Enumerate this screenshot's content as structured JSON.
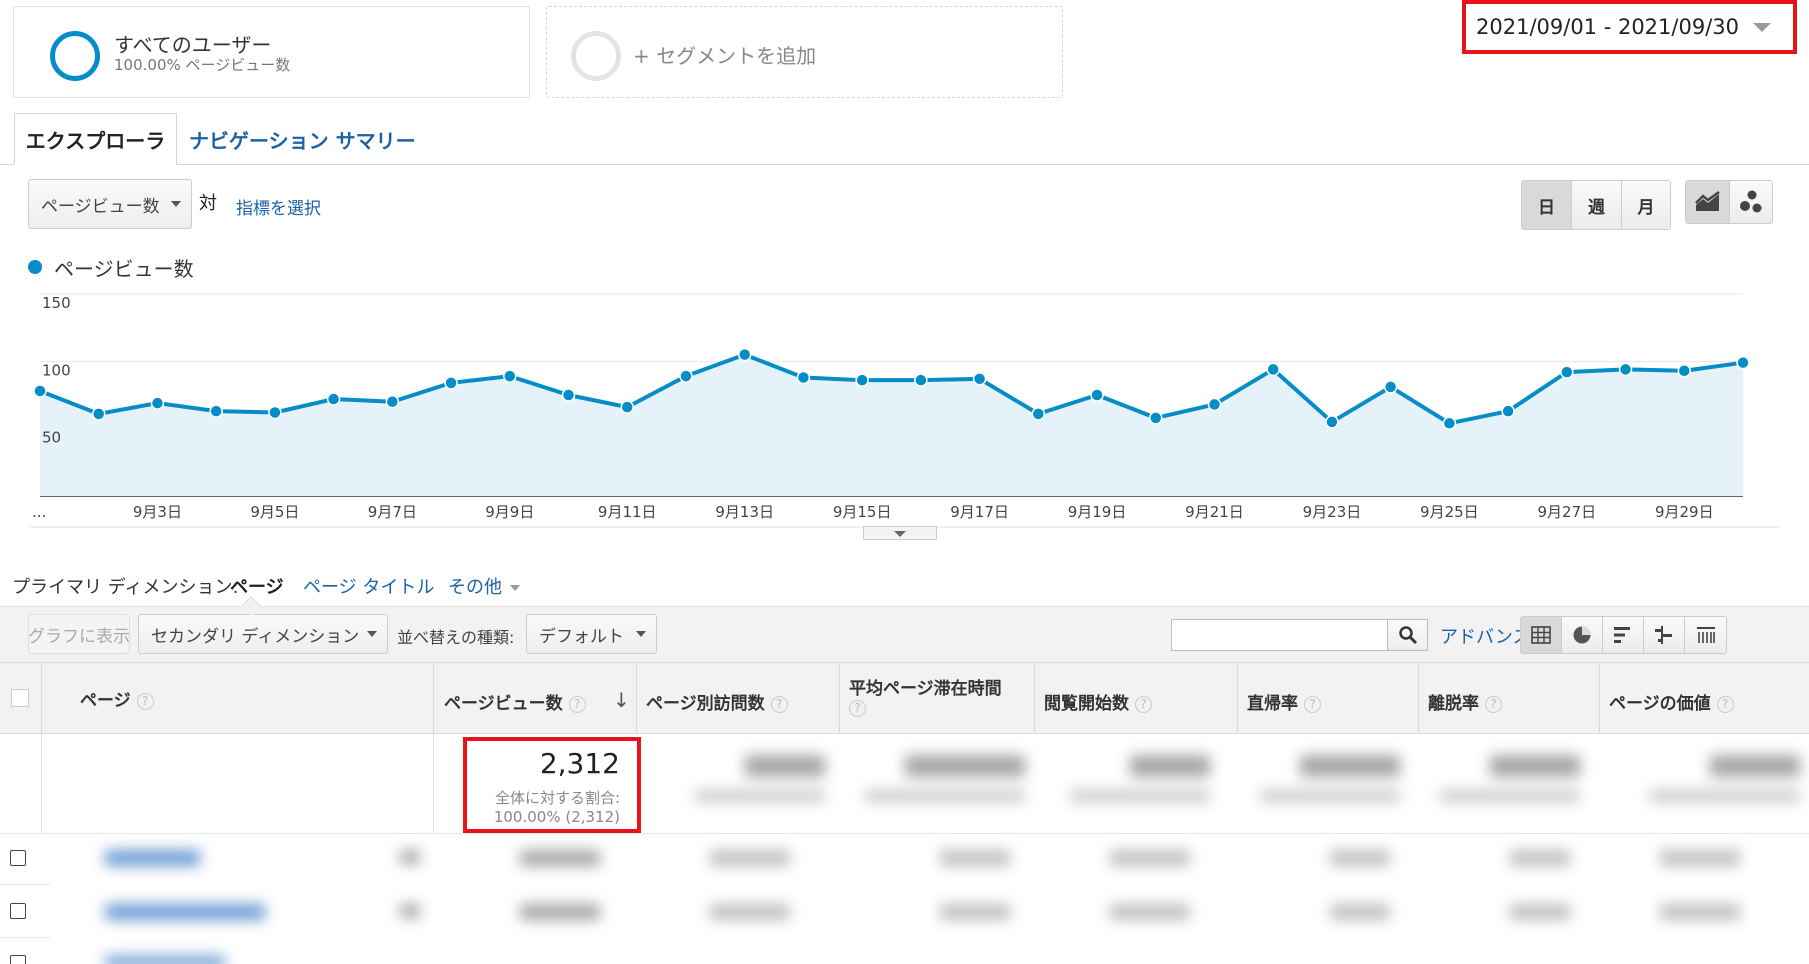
{
  "segments": {
    "all_users": {
      "title": "すべてのユーザー",
      "subtitle": "100.00% ページビュー数"
    },
    "add": {
      "label": "+ セグメントを追加"
    }
  },
  "date_range": "2021/09/01 - 2021/09/30",
  "tabs": {
    "explorer": "エクスプローラ",
    "nav_summary": "ナビゲーション サマリー"
  },
  "metric": {
    "selected": "ページビュー数",
    "vs": "対",
    "choose": "指標を選択"
  },
  "period_buttons": [
    "日",
    "週",
    "月"
  ],
  "chart_data": {
    "type": "area",
    "series": [
      {
        "name": "ページビュー数",
        "values": [
          78,
          61,
          69,
          63,
          62,
          72,
          70,
          84,
          89,
          75,
          66,
          89,
          105,
          88,
          86,
          86,
          87,
          61,
          75,
          58,
          68,
          94,
          55,
          81,
          54,
          63,
          92,
          94,
          93,
          99
        ]
      }
    ],
    "x": [
      "9月1日",
      "9月2日",
      "9月3日",
      "9月4日",
      "9月5日",
      "9月6日",
      "9月7日",
      "9月8日",
      "9月9日",
      "9月10日",
      "9月11日",
      "9月12日",
      "9月13日",
      "9月14日",
      "9月15日",
      "9月16日",
      "9月17日",
      "9月18日",
      "9月19日",
      "9月20日",
      "9月21日",
      "9月22日",
      "9月23日",
      "9月24日",
      "9月25日",
      "9月26日",
      "9月27日",
      "9月28日",
      "9月29日",
      "9月30日"
    ],
    "x_tick_labels": [
      "...",
      "9月3日",
      "9月5日",
      "9月7日",
      "9月9日",
      "9月11日",
      "9月13日",
      "9月15日",
      "9月17日",
      "9月19日",
      "9月21日",
      "9月23日",
      "9月25日",
      "9月27日",
      "9月29日"
    ],
    "y_ticks": [
      "150",
      "100",
      "50"
    ],
    "ylim": [
      0,
      150
    ],
    "grid": true,
    "color": "#058dc7",
    "fill": "#e5f2f9"
  },
  "dimensions": {
    "label": "プライマリ ディメンション:",
    "page": "ページ",
    "page_title": "ページ タイトル",
    "other": "その他"
  },
  "toolbar": {
    "plot_rows": "グラフに表示",
    "secondary_dim": "セカンダリ ディメンション",
    "sort_label": "並べ替えの種類:",
    "sort_value": "デフォルト",
    "search_value": "",
    "advanced": "アドバンス"
  },
  "table": {
    "headers": {
      "page": "ページ",
      "pageviews": "ページビュー数",
      "unique_pageviews": "ページ別訪問数",
      "avg_time": "平均ページ滞在時間",
      "entrances": "閲覧開始数",
      "bounce_rate": "直帰率",
      "exit_rate": "離脱率",
      "page_value": "ページの価値"
    },
    "help": "?",
    "totals": {
      "pageviews": "2,312",
      "share_label": "全体に対する割合:",
      "share_value": "100.00% (2,312)"
    }
  },
  "colors": {
    "accent": "#058dc7",
    "link": "#1b62a8",
    "highlight": "#e8131b"
  }
}
